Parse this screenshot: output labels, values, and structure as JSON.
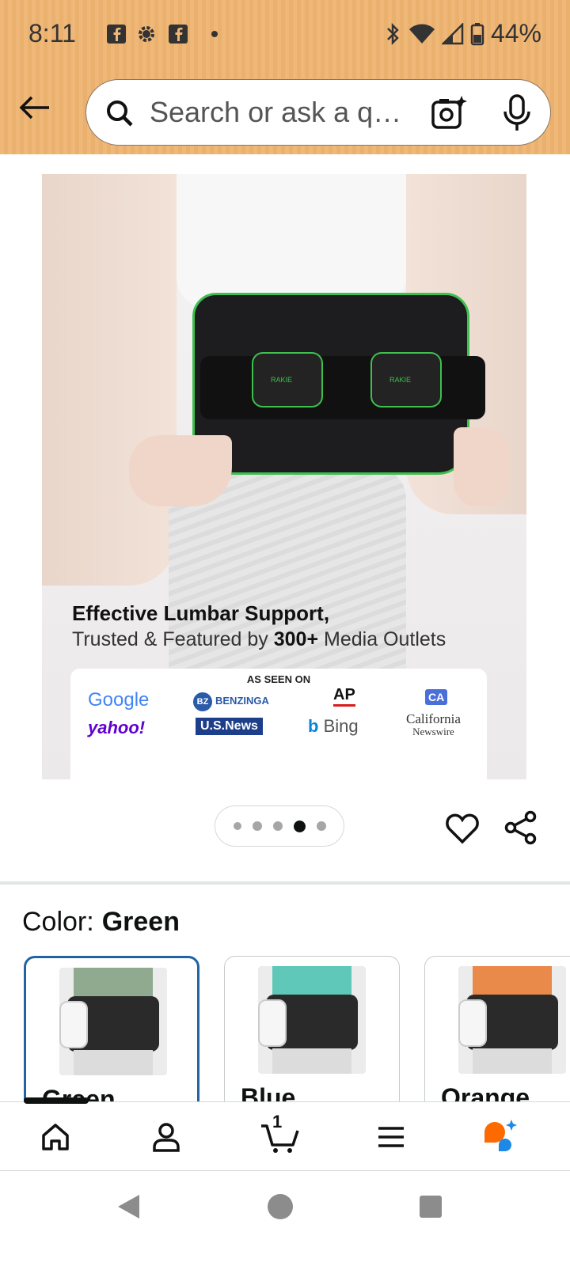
{
  "status_bar": {
    "time": "8:11",
    "battery": "44%",
    "notification_icons": [
      "facebook-icon",
      "settings-icon",
      "facebook-icon",
      "dot-icon"
    ]
  },
  "search": {
    "placeholder": "Search or ask a q…"
  },
  "product_image": {
    "promo_title": "Effective Lumbar Support,",
    "promo_sub_prefix": "Trusted & Featured by ",
    "promo_sub_bold": "300+",
    "promo_sub_suffix": " Media Outlets",
    "as_seen_on": "AS SEEN ON",
    "media_logos": [
      "Google",
      "BENZINGA",
      "AP",
      "CA",
      "yahoo!",
      "U.S.News",
      "Bing",
      "California",
      "Newswire"
    ],
    "benzinga_badge": "BZ",
    "belt_brand": "RAKIE",
    "page_index": 4,
    "page_count": 5
  },
  "color_selector": {
    "label": "Color:",
    "selected": "Green",
    "options": [
      {
        "name": "Green",
        "shirt_color": "#8faa8f"
      },
      {
        "name": "Blue",
        "shirt_color": "#5fc8b8"
      },
      {
        "name": "Orange",
        "shirt_color": "#e98a4a"
      }
    ]
  },
  "bottom_nav": {
    "items": [
      "home-icon",
      "account-icon",
      "cart-icon",
      "menu-icon",
      "rufus-icon"
    ],
    "cart_count": "1"
  },
  "colors": {
    "header_bg": "#f0b878",
    "selected_border": "#2162a1",
    "accent_orange": "#ff6a00",
    "accent_blue": "#1e88e5"
  }
}
